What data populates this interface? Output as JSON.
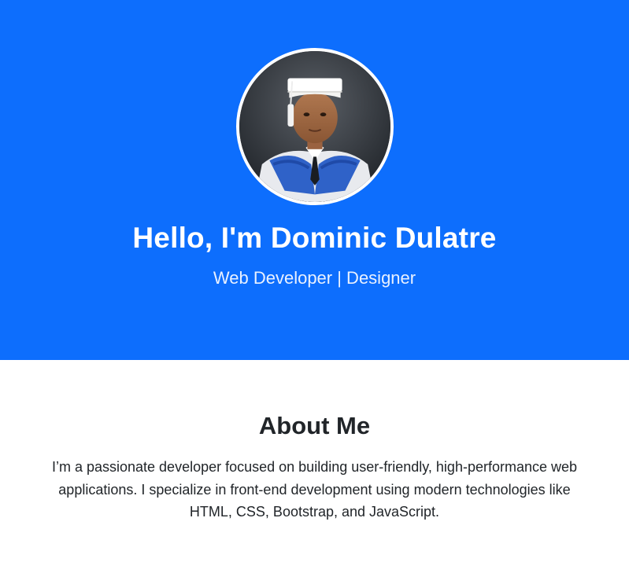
{
  "hero": {
    "title": "Hello, I'm Dominic Dulatre",
    "subtitle": "Web Developer | Designer",
    "background_color": "#0d6efd",
    "avatar_icon": "profile-photo"
  },
  "about": {
    "title": "About Me",
    "text": "I’m a passionate developer focused on building user-friendly, high-performance web applications. I specialize in front-end development using modern technologies like HTML, CSS, Bootstrap, and JavaScript."
  }
}
